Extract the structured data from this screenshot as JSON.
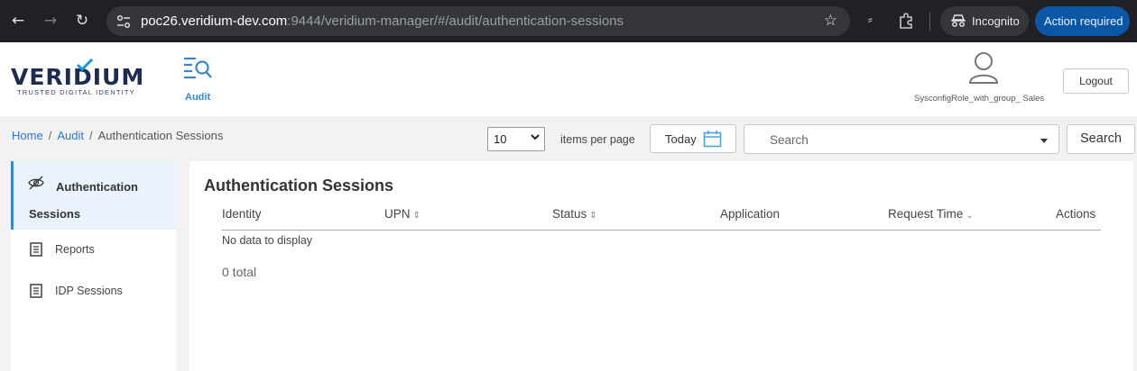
{
  "browser": {
    "url_host": "poc26.veridium-dev.com",
    "url_rest": ":9444/veridium-manager/#/audit/authentication-sessions",
    "incognito_label": "Incognito",
    "action_required_label": "Action required"
  },
  "header": {
    "logo_text": "VERIDIUM",
    "logo_tagline": "TRUSTED DIGITAL IDENTITY",
    "nav_audit_label": "Audit",
    "user_name": "SysconfigRole_with_group_ Sales",
    "logout_label": "Logout"
  },
  "breadcrumb": {
    "home": "Home",
    "audit": "Audit",
    "current": "Authentication Sessions",
    "separator": "/"
  },
  "toolbar": {
    "per_page_value": "10",
    "per_page_label": "items per page",
    "today_label": "Today",
    "search_placeholder": "Search",
    "search_button": "Search"
  },
  "sidebar": {
    "items": [
      {
        "label": "Authentication Sessions",
        "icon": "eye-slash-icon",
        "active": true
      },
      {
        "label": "Reports",
        "icon": "document-icon",
        "active": false
      },
      {
        "label": "IDP Sessions",
        "icon": "document-icon",
        "active": false
      }
    ]
  },
  "main": {
    "title": "Authentication Sessions",
    "columns": [
      {
        "label": "Identity",
        "sort": ""
      },
      {
        "label": "UPN",
        "sort": "⌃⌄"
      },
      {
        "label": "Status",
        "sort": "⌃⌄"
      },
      {
        "label": "Application",
        "sort": ""
      },
      {
        "label": "Request Time",
        "sort": "⌄"
      },
      {
        "label": "Actions",
        "sort": ""
      }
    ],
    "empty_text": "No data to display",
    "total_text": "0 total"
  },
  "colors": {
    "accent": "#3a86c8",
    "chrome_bg": "#202124",
    "action_required_bg": "#0b57a6"
  }
}
